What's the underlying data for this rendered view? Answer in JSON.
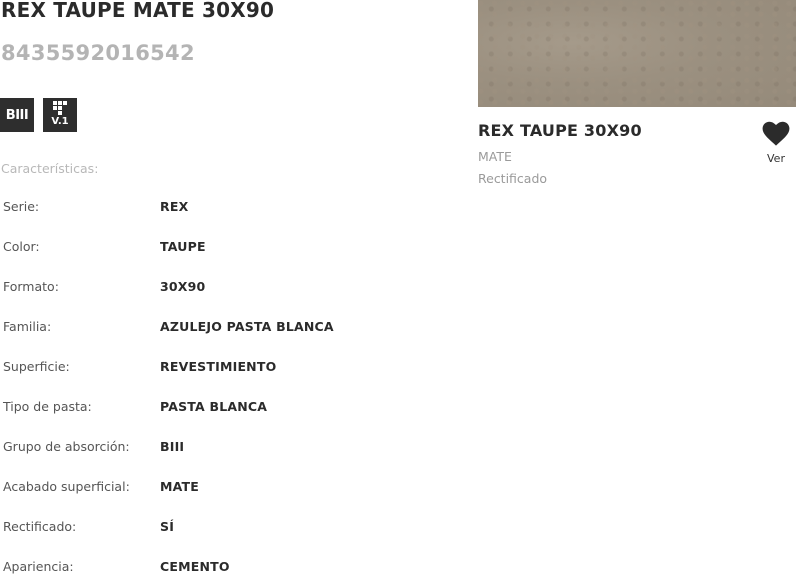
{
  "product": {
    "title": "REX TAUPE MATE 30X90",
    "ean": "8435592016542",
    "badges": {
      "absorption_group": "BIII",
      "version": "V.1"
    }
  },
  "specs": {
    "heading": "Características:",
    "rows": [
      {
        "label": "Serie:",
        "value": "REX"
      },
      {
        "label": "Color:",
        "value": "TAUPE"
      },
      {
        "label": "Formato:",
        "value": "30X90"
      },
      {
        "label": "Familia:",
        "value": "AZULEJO PASTA BLANCA"
      },
      {
        "label": "Superficie:",
        "value": "REVESTIMIENTO"
      },
      {
        "label": "Tipo de pasta:",
        "value": "PASTA BLANCA"
      },
      {
        "label": "Grupo de absorción:",
        "value": "BIII"
      },
      {
        "label": "Acabado superficial:",
        "value": "MATE"
      },
      {
        "label": "Rectificado:",
        "value": "SÍ"
      },
      {
        "label": "Apariencia:",
        "value": "CEMENTO"
      }
    ]
  },
  "related": {
    "title": "REX TAUPE 30X90",
    "finish": "MATE",
    "edge": "Rectificado",
    "favorite_label": "Ver",
    "image_color": "#9b9080"
  },
  "colors": {
    "badge_bg": "#2e2e2e",
    "ean_gray": "#b4b4b4"
  },
  "icons": {
    "favorite": "heart-icon",
    "version_badge": "grid-version-icon"
  }
}
